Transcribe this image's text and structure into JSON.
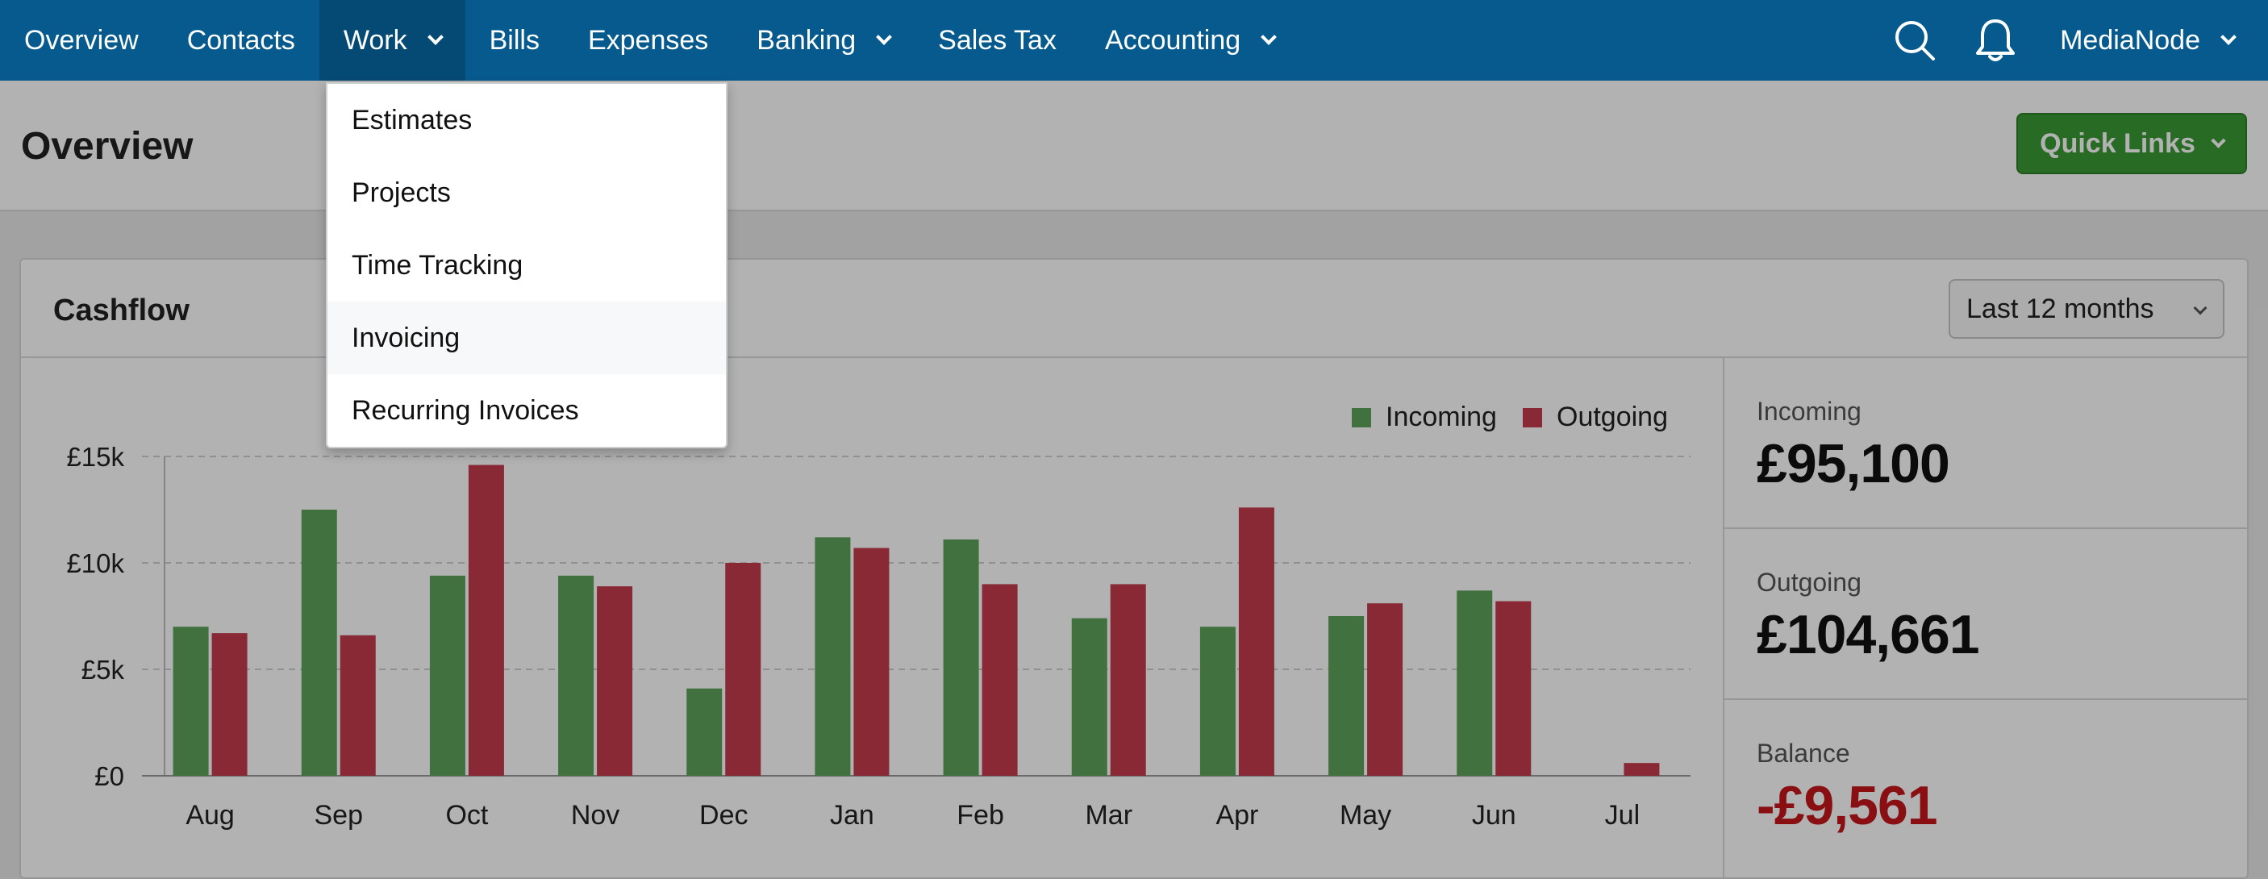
{
  "nav": {
    "items": [
      {
        "label": "Overview"
      },
      {
        "label": "Contacts"
      },
      {
        "label": "Work"
      },
      {
        "label": "Bills"
      },
      {
        "label": "Expenses"
      },
      {
        "label": "Banking"
      },
      {
        "label": "Sales Tax"
      },
      {
        "label": "Accounting"
      }
    ],
    "account": "MediaNode",
    "search_icon": "search-icon",
    "notification_icon": "bell-icon"
  },
  "page": {
    "title": "Overview",
    "quick_links": "Quick Links"
  },
  "cashflow": {
    "title": "Cashflow",
    "period": "Last 12 months",
    "stats": [
      {
        "label": "Incoming",
        "value": "£95,100"
      },
      {
        "label": "Outgoing",
        "value": "£104,661"
      },
      {
        "label": "Balance",
        "value": "-£9,561"
      }
    ]
  },
  "work_menu": {
    "items": [
      "Estimates",
      "Projects",
      "Time Tracking",
      "Invoicing",
      "Recurring Invoices"
    ],
    "highlighted": "Invoicing"
  },
  "colors": {
    "nav_bg": "#075a8d",
    "incoming": "#5ca35a",
    "outgoing": "#c43c4c",
    "quick_links": "#3a9a34",
    "negative": "#c4161c"
  },
  "chart_data": {
    "type": "bar",
    "categories": [
      "Aug",
      "Sep",
      "Oct",
      "Nov",
      "Dec",
      "Jan",
      "Feb",
      "Mar",
      "Apr",
      "May",
      "Jun",
      "Jul"
    ],
    "series": [
      {
        "name": "Incoming",
        "values": [
          7000,
          12500,
          9400,
          9400,
          4100,
          11200,
          11100,
          7400,
          7000,
          7500,
          8700,
          0
        ]
      },
      {
        "name": "Outgoing",
        "values": [
          6700,
          6600,
          14600,
          8900,
          10000,
          10700,
          9000,
          9000,
          12600,
          8100,
          8200,
          600
        ]
      }
    ],
    "yticks": [
      "£0",
      "£5k",
      "£10k",
      "£15k"
    ],
    "ylim": [
      0,
      15000
    ],
    "grid": true,
    "legend": "top-right"
  }
}
